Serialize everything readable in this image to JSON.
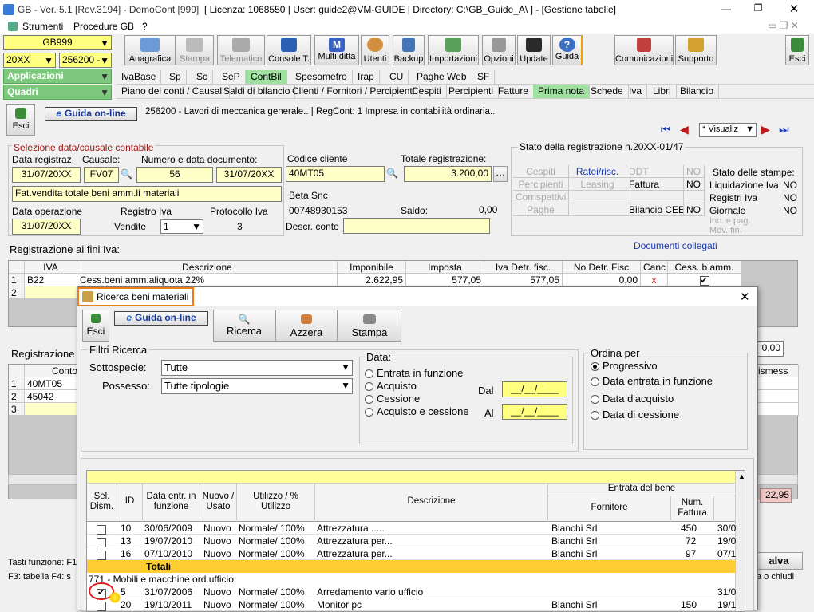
{
  "titlebar": {
    "title": "GB - Ver. 5.1 [Rev.3194] - DemoCont [999]",
    "info": "[ Licenza: 1068550 | User: guide2@VM-GUIDE | Directory: C:\\GB_Guide_A\\ ] - [Gestione tabelle]"
  },
  "menubar": {
    "items": [
      "Strumenti",
      "Procedure GB",
      "?"
    ]
  },
  "left": {
    "code": "GB999",
    "year": "20XX",
    "ditta": "256200 -",
    "applicazioni": "Applicazioni",
    "quadri": "Quadri"
  },
  "toolbar": {
    "buttons": [
      "Anagrafica",
      "Stampa",
      "Telematico",
      "Console T.",
      "Multi ditta",
      "Utenti",
      "Backup",
      "Importazioni",
      "Opzioni",
      "Update",
      "Guida",
      "Comunicazioni",
      "Supporto",
      "Esci"
    ]
  },
  "tabs1": [
    "IvaBase",
    "Sp",
    "Sc",
    "SeP",
    "ContBil",
    "Spesometro",
    "Irap",
    "CU",
    "Paghe Web",
    "SF"
  ],
  "tabs2": [
    "Piano dei conti / Causali",
    "Saldi di bilancio",
    "Clienti / Fornitori / Percipienti",
    "Cespiti",
    "Percipienti",
    "Fatture",
    "Prima nota",
    "Schede",
    "Iva",
    "Libri",
    "Bilancio"
  ],
  "sub": {
    "esci": "Esci",
    "guida": "Guida on-line",
    "info": "256200 - Lavori di meccanica generale.. | RegCont: 1 Impresa  in contabilità ordinaria..",
    "visualizza": "* Visualiz"
  },
  "form": {
    "sel_title": "Selezione data/causale contabile",
    "data_reg_lbl": "Data registraz.",
    "causale_lbl": "Causale:",
    "numdoc_lbl": "Numero e data documento:",
    "data_reg": "31/07/20XX",
    "causale": "FV07",
    "numero": "56",
    "data_doc": "31/07/20XX",
    "descr": "Fat.vendita totale beni amm.li materiali",
    "data_op_lbl": "Data operazione",
    "registro_lbl": "Registro Iva",
    "protocollo_lbl": "Protocollo Iva",
    "data_op": "31/07/20XX",
    "vendite": "Vendite",
    "registro_num": "1",
    "protocollo": "3",
    "cod_cli_lbl": "Codice cliente",
    "tot_lbl": "Totale registrazione:",
    "cod_cli": "40MT05",
    "totale": "3.200,00",
    "cliente": "Beta Snc",
    "piva": "00748930153",
    "saldo_lbl": "Saldo:",
    "saldo": "0,00",
    "descr_conto_lbl": "Descr. conto",
    "stato_title": "Stato della registrazione n.20XX-01/47",
    "stato_rows": [
      [
        "Cespiti",
        "Ratei/risc.",
        "DDT",
        "NO"
      ],
      [
        "Percipienti",
        "Leasing",
        "Fattura",
        "NO"
      ],
      [
        "Corrispettivi",
        "",
        "",
        ""
      ],
      [
        "Paghe",
        "",
        "Bilancio CEE",
        "NO"
      ]
    ],
    "stampe_title": "Stato delle stampe:",
    "stampe": [
      [
        "Liquidazione Iva",
        "NO"
      ],
      [
        "Registri Iva",
        "NO"
      ],
      [
        "Giornale",
        "NO"
      ],
      [
        "Inc. e pag. Mov. fin.",
        ""
      ]
    ]
  },
  "iva": {
    "title": "Registrazione ai fini Iva:",
    "doc_collegati": "Documenti collegati",
    "headers": [
      "IVA",
      "Descrizione",
      "Imponibile",
      "Imposta",
      "Iva Detr. fisc.",
      "No Detr. Fisc",
      "Canc",
      "Cess. b.amm."
    ],
    "rows": [
      {
        "n": "1",
        "iva": "B22",
        "descr": "Cess.beni amm.aliquota 22%",
        "imp": "2.622,95",
        "imposta": "577,05",
        "detr": "577,05",
        "nodetr": "0,00",
        "canc": "x"
      },
      {
        "n": "2"
      }
    ]
  },
  "reg2": {
    "title": "Registrazione",
    "conto_hdr": "Conto",
    "rows": [
      {
        "n": "1",
        "conto": "40MT05"
      },
      {
        "n": "2",
        "conto": "45042"
      },
      {
        "n": "3",
        "conto": ""
      }
    ],
    "right_value": "0,00",
    "right_hdr": "ismess",
    "red_value": "22,95"
  },
  "footer": {
    "line1": "Tasti funzione: F1",
    "line2": "F3: tabella  F4: s",
    "salva": "alva",
    "chiudi": "a o chiudi"
  },
  "dialog": {
    "title": "Ricerca beni materiali",
    "esci": "Esci",
    "guida": "Guida on-line",
    "ricerca": "Ricerca",
    "azzera": "Azzera",
    "stampa": "Stampa",
    "filtri": "Filtri Ricerca",
    "sottospecie_lbl": "Sottospecie:",
    "sottospecie": "Tutte",
    "possesso_lbl": "Possesso:",
    "possesso": "Tutte tipologie",
    "data_lbl": "Data:",
    "data_opts": [
      "Entrata in funzione",
      "Acquisto",
      "Cessione",
      "Acquisto e cessione"
    ],
    "dal_lbl": "Dal",
    "al_lbl": "Al",
    "dal": "__/__/____",
    "al": "__/__/____",
    "ordina_lbl": "Ordina per",
    "ordina_opts": [
      "Progressivo",
      "Data entrata in funzione",
      "Data d'acquisto",
      "Data di cessione"
    ],
    "grid_headers": {
      "sel": "Sel. Dism.",
      "id": "ID",
      "data": "Data entr. in funzione",
      "nuovo": "Nuovo / Usato",
      "utilizzo": "Utilizzo / % Utilizzo",
      "descr": "Descrizione",
      "entrata": "Entrata del bene",
      "fornitore": "Fornitore",
      "num": "Num. Fattura"
    },
    "rows": [
      {
        "id": "10",
        "data": "30/06/2009",
        "nuovo": "Nuovo",
        "util": "Normale/ 100%",
        "descr": "Attrezzatura .....",
        "forn": "Bianchi Srl",
        "num": "450",
        "d2": "30/0"
      },
      {
        "id": "13",
        "data": "19/07/2010",
        "nuovo": "Nuovo",
        "util": "Normale/ 100%",
        "descr": "Attrezzatura per...",
        "forn": "Bianchi Srl",
        "num": "72",
        "d2": "19/0"
      },
      {
        "id": "16",
        "data": "07/10/2010",
        "nuovo": "Nuovo",
        "util": "Normale/ 100%",
        "descr": "Attrezzatura per...",
        "forn": "Bianchi Srl",
        "num": "97",
        "d2": "07/1"
      }
    ],
    "totali": "Totali",
    "group": "771 - Mobili e macchine ord.ufficio",
    "rows2": [
      {
        "id": "5",
        "data": "31/07/2006",
        "nuovo": "Nuovo",
        "util": "Normale/ 100%",
        "descr": "Arredamento vario ufficio",
        "forn": "",
        "num": "",
        "d2": "31/0",
        "checked": true
      },
      {
        "id": "20",
        "data": "19/10/2011",
        "nuovo": "Nuovo",
        "util": "Normale/ 100%",
        "descr": "Monitor pc",
        "forn": "Bianchi Srl",
        "num": "150",
        "d2": "19/1",
        "checked": false
      }
    ]
  }
}
